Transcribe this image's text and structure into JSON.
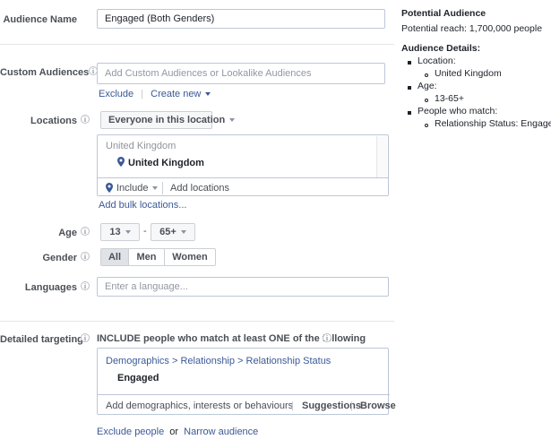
{
  "form": {
    "audience_name": {
      "label": "Audience Name",
      "value": "Engaged (Both Genders)"
    },
    "custom_audiences": {
      "label": "Custom Audiences",
      "placeholder": "Add Custom Audiences or Lookalike Audiences",
      "exclude_link": "Exclude",
      "create_new_link": "Create new",
      "pipe": "|"
    },
    "locations": {
      "label": "Locations",
      "scope_dropdown": "Everyone in this location",
      "list_header": "United Kingdom",
      "selected_location": "United Kingdom",
      "include_label": "Include",
      "add_locations_placeholder": "Add locations",
      "bulk_link": "Add bulk locations..."
    },
    "age": {
      "label": "Age",
      "min": "13",
      "max": "65+",
      "separator": "-"
    },
    "gender": {
      "label": "Gender",
      "options": [
        "All",
        "Men",
        "Women"
      ],
      "selected": "All"
    },
    "languages": {
      "label": "Languages",
      "placeholder": "Enter a language..."
    },
    "detailed_targeting": {
      "label": "Detailed targeting",
      "heading": "INCLUDE people who match at least ONE of the following",
      "breadcrumb": "Demographics > Relationship > Relationship Status",
      "selected_value": "Engaged",
      "input_placeholder": "Add demographics, interests or behaviours",
      "suggestions_label": "Suggestions",
      "browse_label": "Browse",
      "pipe": "|",
      "exclude_people_link": "Exclude people",
      "or_text": "or",
      "narrow_audience_link": "Narrow audience"
    }
  },
  "right_panel": {
    "potential_audience_title": "Potential Audience",
    "potential_reach": "Potential reach: 1,700,000 people",
    "audience_details_title": "Audience Details:",
    "details": [
      {
        "label": "Location:",
        "sub": "United Kingdom"
      },
      {
        "label": "Age:",
        "sub": "13-65+"
      },
      {
        "label": "People who match:",
        "sub": "Relationship Status: Engaged"
      }
    ]
  },
  "colors": {
    "link": "#3b5998",
    "label": "#4b4f56",
    "placeholder": "#9197a3",
    "border": "#bdc7d8",
    "divider": "#e3e5e8",
    "segment_active": "#dfe2e7"
  }
}
